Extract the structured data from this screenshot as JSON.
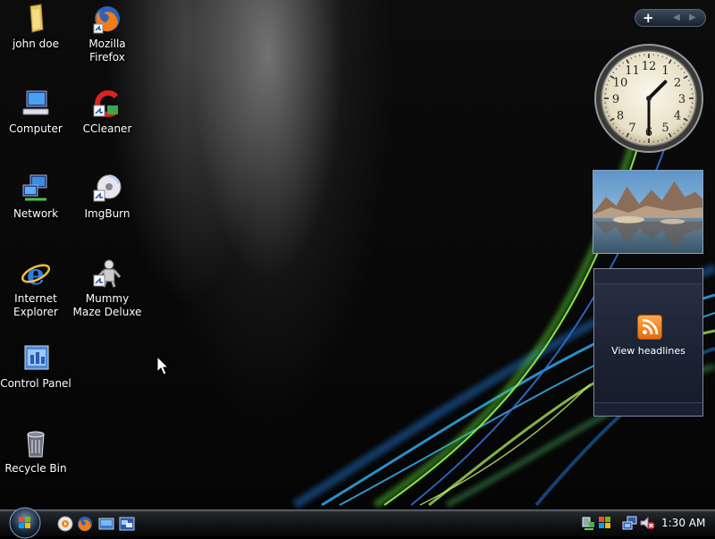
{
  "desktop_icons": [
    {
      "label": "john doe",
      "icon": "user-folder-icon"
    },
    {
      "label": "Mozilla Firefox",
      "icon": "firefox-icon"
    },
    {
      "label": "Computer",
      "icon": "computer-icon"
    },
    {
      "label": "CCleaner",
      "icon": "ccleaner-icon"
    },
    {
      "label": "Network",
      "icon": "network-icon"
    },
    {
      "label": "ImgBurn",
      "icon": "imgburn-icon"
    },
    {
      "label": "Internet Explorer",
      "icon": "internet-explorer-icon"
    },
    {
      "label": "Mummy Maze Deluxe",
      "icon": "mummy-maze-icon"
    },
    {
      "label": "Control Panel",
      "icon": "control-panel-icon"
    },
    {
      "label": "Recycle Bin",
      "icon": "recycle-bin-icon"
    }
  ],
  "sidebar": {
    "controls": {
      "add": "+",
      "prev": "◀",
      "next": "▶"
    },
    "clock": {
      "hour": 1,
      "minute": 30,
      "numbers": [
        "12",
        "1",
        "2",
        "3",
        "4",
        "5",
        "6",
        "7",
        "8",
        "9",
        "10",
        "11"
      ]
    },
    "feed": {
      "label": "View headlines",
      "icon": "rss-icon"
    }
  },
  "taskbar": {
    "start_icon": "windows-start-orb-icon",
    "quick_launch": [
      "media-player-icon",
      "firefox-icon",
      "show-desktop-icon",
      "switch-windows-icon"
    ],
    "tray_icons": [
      "network-status-icon",
      "windows-update-icon",
      "network-icon",
      "volume-muted-icon"
    ],
    "time": "1:30 AM"
  },
  "colors": {
    "accent_green": "#7dd83a",
    "accent_blue": "#2f8ee0",
    "rss_orange": "#f48a1e"
  }
}
